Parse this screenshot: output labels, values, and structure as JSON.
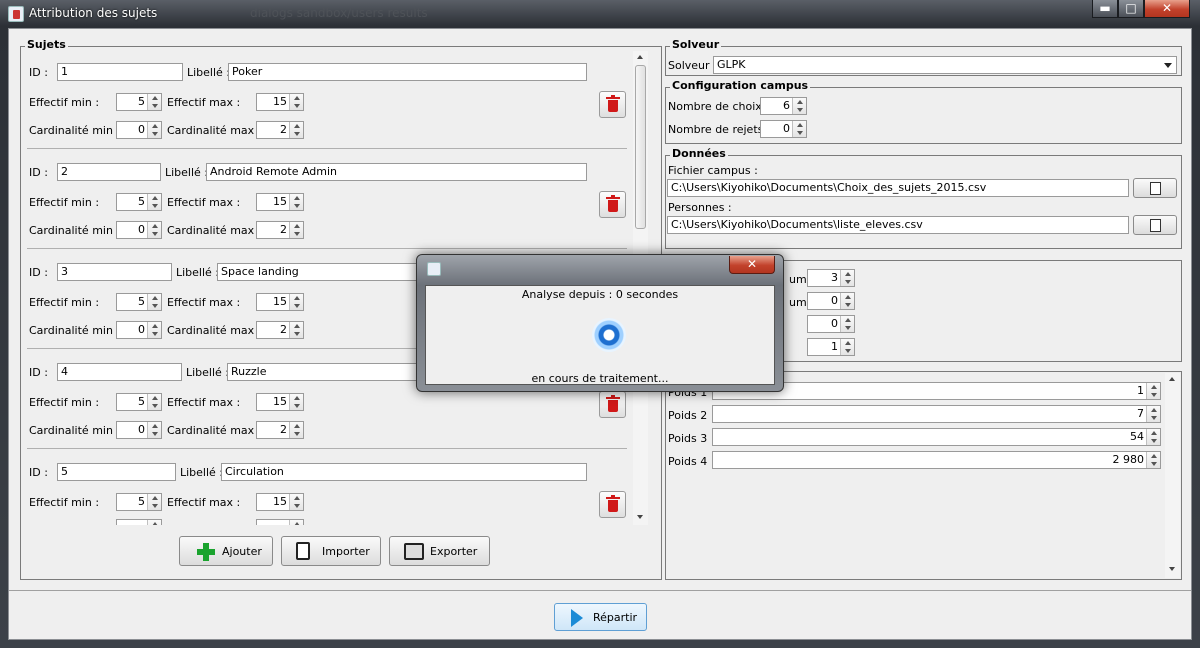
{
  "window": {
    "title": "Attribution des sujets",
    "ghost_title": "dialogs  sandbox/users  results",
    "minimize": "▬",
    "maximize": "□",
    "close": "✕"
  },
  "sujets": {
    "legend": "Sujets",
    "labels": {
      "id": "ID :",
      "libelle": "Libellé :",
      "eff_min": "Effectif min :",
      "eff_max": "Effectif max :",
      "card_min": "Cardinalité min :",
      "card_max": "Cardinalité max :"
    },
    "items": [
      {
        "id": "1",
        "libelle": "Poker",
        "eff_min": "5",
        "eff_max": "15",
        "card_min": "0",
        "card_max": "2"
      },
      {
        "id": "2",
        "libelle": "Android Remote Admin",
        "eff_min": "5",
        "eff_max": "15",
        "card_min": "0",
        "card_max": "2"
      },
      {
        "id": "3",
        "libelle": "Space landing",
        "eff_min": "5",
        "eff_max": "15",
        "card_min": "0",
        "card_max": "2"
      },
      {
        "id": "4",
        "libelle": "Ruzzle",
        "eff_min": "5",
        "eff_max": "15",
        "card_min": "0",
        "card_max": "2"
      },
      {
        "id": "5",
        "libelle": "Circulation",
        "eff_min": "5",
        "eff_max": "15"
      }
    ],
    "buttons": {
      "add": "Ajouter",
      "import": "Importer",
      "export": "Exporter"
    }
  },
  "solveur": {
    "legend": "Solveur",
    "label": "Solveur :",
    "value": "GLPK"
  },
  "campus": {
    "legend": "Configuration campus",
    "nb_choix_label": "Nombre de choix :",
    "nb_choix": "6",
    "nb_rejets_label": "Nombre de rejets :",
    "nb_rejets": "0"
  },
  "donnees": {
    "legend": "Données",
    "fichier_label": "Fichier campus :",
    "fichier": "C:\\Users\\Kiyohiko\\Documents\\Choix_des_sujets_2015.csv",
    "personnes_label": "Personnes :",
    "personnes": "C:\\Users\\Kiyohiko\\Documents\\liste_eleves.csv"
  },
  "params": {
    "label_1": "um :",
    "label_2": "um :",
    "values": [
      "3",
      "0",
      "0",
      "1"
    ]
  },
  "poids": {
    "labels": [
      "Poids 1 :",
      "Poids 2 :",
      "Poids 3 :",
      "Poids 4 :"
    ],
    "values": [
      "1",
      "7",
      "54",
      "2 980"
    ]
  },
  "repartir": "Répartir",
  "dialog": {
    "status": "Analyse depuis : 0 secondes",
    "progress": "en cours de traitement...",
    "close": "✕"
  }
}
